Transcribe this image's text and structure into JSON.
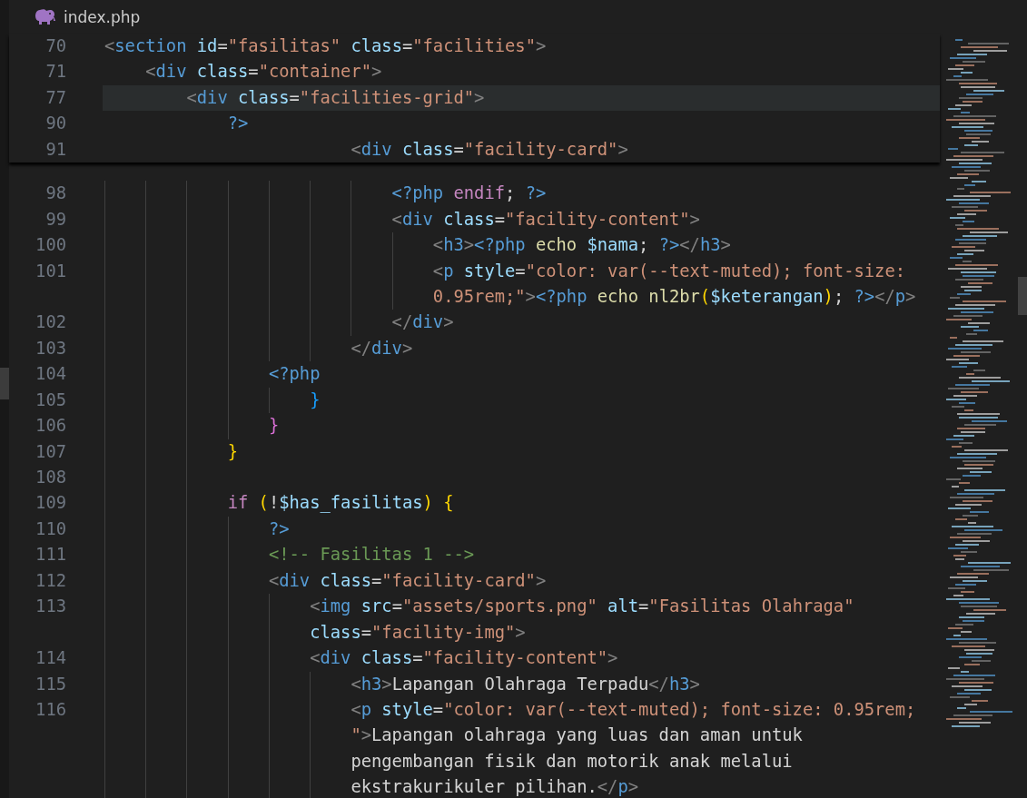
{
  "header": {
    "file_name": "index.php"
  },
  "sticky_lines": [
    {
      "number": "70",
      "highlighted": false,
      "tokens": [
        {
          "kind": "punct",
          "text": "<"
        },
        {
          "kind": "tag",
          "text": "section"
        },
        {
          "kind": "attr",
          "text": " id"
        },
        {
          "kind": "text",
          "text": "="
        },
        {
          "kind": "string",
          "text": "\"fasilitas\""
        },
        {
          "kind": "attr",
          "text": " class"
        },
        {
          "kind": "text",
          "text": "="
        },
        {
          "kind": "string",
          "text": "\"facilities\""
        },
        {
          "kind": "punct",
          "text": ">"
        }
      ]
    },
    {
      "number": "71",
      "highlighted": false,
      "tokens": [
        {
          "kind": "punct",
          "text": "    <"
        },
        {
          "kind": "tag",
          "text": "div"
        },
        {
          "kind": "attr",
          "text": " class"
        },
        {
          "kind": "text",
          "text": "="
        },
        {
          "kind": "string",
          "text": "\"container\""
        },
        {
          "kind": "punct",
          "text": ">"
        }
      ]
    },
    {
      "number": "77",
      "highlighted": true,
      "tokens": [
        {
          "kind": "punct",
          "text": "        <"
        },
        {
          "kind": "tag",
          "text": "div"
        },
        {
          "kind": "attr",
          "text": " class"
        },
        {
          "kind": "text",
          "text": "="
        },
        {
          "kind": "string",
          "text": "\"facilities-grid\""
        },
        {
          "kind": "punct",
          "text": ">"
        }
      ]
    },
    {
      "number": "90",
      "highlighted": false,
      "tokens": [
        {
          "kind": "php",
          "text": "            ?>"
        }
      ]
    },
    {
      "number": "91",
      "highlighted": false,
      "tokens": [
        {
          "kind": "punct",
          "text": "                        <"
        },
        {
          "kind": "tag",
          "text": "div"
        },
        {
          "kind": "attr",
          "text": " class"
        },
        {
          "kind": "text",
          "text": "="
        },
        {
          "kind": "string",
          "text": "\"facility-card\""
        },
        {
          "kind": "punct",
          "text": ">"
        }
      ]
    }
  ],
  "lines": [
    {
      "number": "98",
      "tokens": [
        {
          "kind": "php",
          "text": "                            <?php"
        },
        {
          "kind": "keyword",
          "text": " endif"
        },
        {
          "kind": "text",
          "text": "; "
        },
        {
          "kind": "php",
          "text": "?>"
        }
      ]
    },
    {
      "number": "99",
      "tokens": [
        {
          "kind": "punct",
          "text": "                            <"
        },
        {
          "kind": "tag",
          "text": "div"
        },
        {
          "kind": "attr",
          "text": " class"
        },
        {
          "kind": "text",
          "text": "="
        },
        {
          "kind": "string",
          "text": "\"facility-content\""
        },
        {
          "kind": "punct",
          "text": ">"
        }
      ]
    },
    {
      "number": "100",
      "tokens": [
        {
          "kind": "punct",
          "text": "                                <"
        },
        {
          "kind": "tag",
          "text": "h3"
        },
        {
          "kind": "punct",
          "text": ">"
        },
        {
          "kind": "php",
          "text": "<?php"
        },
        {
          "kind": "function",
          "text": " echo"
        },
        {
          "kind": "variable",
          "text": " $nama"
        },
        {
          "kind": "text",
          "text": "; "
        },
        {
          "kind": "php",
          "text": "?>"
        },
        {
          "kind": "punct",
          "text": "</"
        },
        {
          "kind": "tag",
          "text": "h3"
        },
        {
          "kind": "punct",
          "text": ">"
        }
      ]
    },
    {
      "number": "101",
      "tokens": [
        {
          "kind": "punct",
          "text": "                                <"
        },
        {
          "kind": "tag",
          "text": "p"
        },
        {
          "kind": "attr",
          "text": " style"
        },
        {
          "kind": "text",
          "text": "="
        },
        {
          "kind": "string",
          "text": "\"color: var(--text-muted); font-size:"
        }
      ]
    },
    {
      "tokens": [
        {
          "kind": "string",
          "text": "                                0.95rem;\""
        },
        {
          "kind": "punct",
          "text": ">"
        },
        {
          "kind": "php",
          "text": "<?php"
        },
        {
          "kind": "function",
          "text": " echo"
        },
        {
          "kind": "function",
          "text": " nl2br"
        },
        {
          "kind": "bracket1",
          "text": "("
        },
        {
          "kind": "variable",
          "text": "$keterangan"
        },
        {
          "kind": "bracket1",
          "text": ")"
        },
        {
          "kind": "text",
          "text": "; "
        },
        {
          "kind": "php",
          "text": "?>"
        },
        {
          "kind": "punct",
          "text": "</"
        },
        {
          "kind": "tag",
          "text": "p"
        },
        {
          "kind": "punct",
          "text": ">"
        }
      ]
    },
    {
      "number": "102",
      "tokens": [
        {
          "kind": "punct",
          "text": "                            </"
        },
        {
          "kind": "tag",
          "text": "div"
        },
        {
          "kind": "punct",
          "text": ">"
        }
      ]
    },
    {
      "number": "103",
      "tokens": [
        {
          "kind": "punct",
          "text": "                        </"
        },
        {
          "kind": "tag",
          "text": "div"
        },
        {
          "kind": "punct",
          "text": ">"
        }
      ]
    },
    {
      "number": "104",
      "tokens": [
        {
          "kind": "php",
          "text": "                <?php"
        }
      ]
    },
    {
      "number": "105",
      "tokens": [
        {
          "kind": "bracket3",
          "text": "                    }"
        }
      ]
    },
    {
      "number": "106",
      "tokens": [
        {
          "kind": "bracket2",
          "text": "                }"
        }
      ]
    },
    {
      "number": "107",
      "tokens": [
        {
          "kind": "bracket1",
          "text": "            }"
        }
      ]
    },
    {
      "number": "108"
    },
    {
      "number": "109",
      "tokens": [
        {
          "kind": "keyword",
          "text": "            if"
        },
        {
          "kind": "bracket1",
          "text": " ("
        },
        {
          "kind": "text",
          "text": "!"
        },
        {
          "kind": "variable",
          "text": "$has_fasilitas"
        },
        {
          "kind": "bracket1",
          "text": ")"
        },
        {
          "kind": "bracket1",
          "text": " {"
        }
      ]
    },
    {
      "number": "110",
      "tokens": [
        {
          "kind": "php",
          "text": "                ?>"
        }
      ]
    },
    {
      "number": "111",
      "tokens": [
        {
          "kind": "comment",
          "text": "                <!-- Fasilitas 1 -->"
        }
      ]
    },
    {
      "number": "112",
      "tokens": [
        {
          "kind": "punct",
          "text": "                <"
        },
        {
          "kind": "tag",
          "text": "div"
        },
        {
          "kind": "attr",
          "text": " class"
        },
        {
          "kind": "text",
          "text": "="
        },
        {
          "kind": "string",
          "text": "\"facility-card\""
        },
        {
          "kind": "punct",
          "text": ">"
        }
      ]
    },
    {
      "number": "113",
      "tokens": [
        {
          "kind": "punct",
          "text": "                    <"
        },
        {
          "kind": "tag",
          "text": "img"
        },
        {
          "kind": "attr",
          "text": " src"
        },
        {
          "kind": "text",
          "text": "="
        },
        {
          "kind": "string",
          "text": "\"assets/sports.png\""
        },
        {
          "kind": "attr",
          "text": " alt"
        },
        {
          "kind": "text",
          "text": "="
        },
        {
          "kind": "string",
          "text": "\"Fasilitas Olahraga\""
        }
      ]
    },
    {
      "tokens": [
        {
          "kind": "attr",
          "text": "                    class"
        },
        {
          "kind": "text",
          "text": "="
        },
        {
          "kind": "string",
          "text": "\"facility-img\""
        },
        {
          "kind": "punct",
          "text": ">"
        }
      ]
    },
    {
      "number": "114",
      "tokens": [
        {
          "kind": "punct",
          "text": "                    <"
        },
        {
          "kind": "tag",
          "text": "div"
        },
        {
          "kind": "attr",
          "text": " class"
        },
        {
          "kind": "text",
          "text": "="
        },
        {
          "kind": "string",
          "text": "\"facility-content\""
        },
        {
          "kind": "punct",
          "text": ">"
        }
      ]
    },
    {
      "number": "115",
      "tokens": [
        {
          "kind": "punct",
          "text": "                        <"
        },
        {
          "kind": "tag",
          "text": "h3"
        },
        {
          "kind": "punct",
          "text": ">"
        },
        {
          "kind": "text",
          "text": "Lapangan Olahraga Terpadu"
        },
        {
          "kind": "punct",
          "text": "</"
        },
        {
          "kind": "tag",
          "text": "h3"
        },
        {
          "kind": "punct",
          "text": ">"
        }
      ]
    },
    {
      "number": "116",
      "tokens": [
        {
          "kind": "punct",
          "text": "                        <"
        },
        {
          "kind": "tag",
          "text": "p"
        },
        {
          "kind": "attr",
          "text": " style"
        },
        {
          "kind": "text",
          "text": "="
        },
        {
          "kind": "string",
          "text": "\"color: var(--text-muted); font-size: 0.95rem;"
        }
      ]
    },
    {
      "tokens": [
        {
          "kind": "string",
          "text": "                        \""
        },
        {
          "kind": "punct",
          "text": ">"
        },
        {
          "kind": "text",
          "text": "Lapangan olahraga yang luas dan aman untuk"
        }
      ]
    },
    {
      "tokens": [
        {
          "kind": "text",
          "text": "                        pengembangan fisik dan motorik anak melalui"
        }
      ]
    },
    {
      "tokens": [
        {
          "kind": "text",
          "text": "                        ekstrakurikuler pilihan."
        },
        {
          "kind": "punct",
          "text": "</"
        },
        {
          "kind": "tag",
          "text": "p"
        },
        {
          "kind": "punct",
          "text": ">"
        }
      ]
    }
  ]
}
